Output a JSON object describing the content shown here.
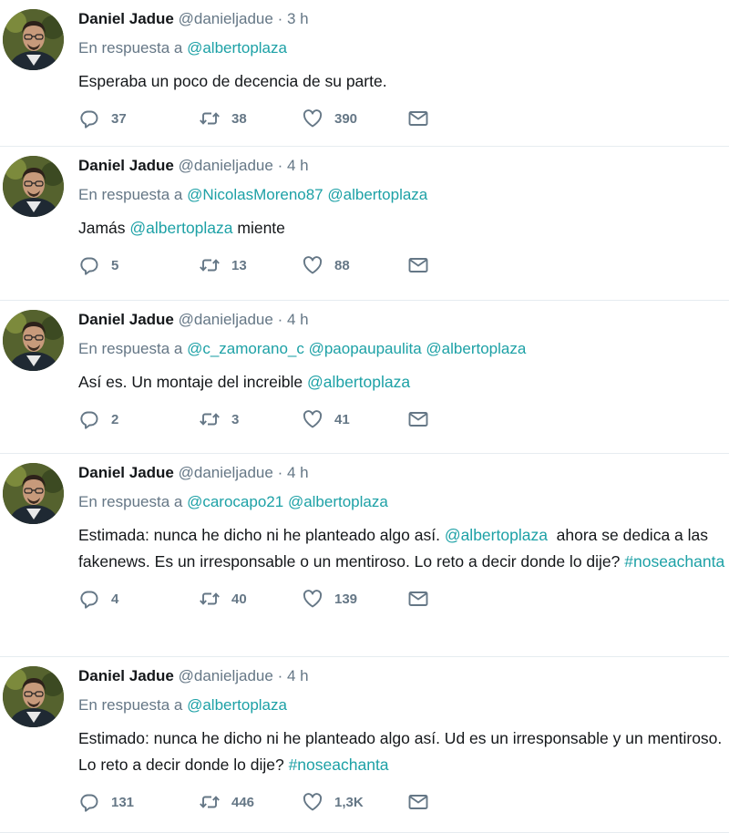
{
  "tweets": [
    {
      "name": "Daniel Jadue",
      "handle": "@danieljadue",
      "separator": "·",
      "time": "3 h",
      "reply_prefix": "En respuesta a",
      "reply_to": [
        "@albertoplaza"
      ],
      "text": [
        {
          "t": "Esperaba un poco de decencia de su parte.",
          "k": "plain"
        }
      ],
      "replies": "37",
      "retweets": "38",
      "likes": "390"
    },
    {
      "name": "Daniel Jadue",
      "handle": "@danieljadue",
      "separator": "·",
      "time": "4 h",
      "reply_prefix": "En respuesta a",
      "reply_to": [
        "@NicolasMoreno87",
        "@albertoplaza"
      ],
      "text": [
        {
          "t": "Jamás ",
          "k": "plain"
        },
        {
          "t": "@albertoplaza",
          "k": "mention"
        },
        {
          "t": " miente",
          "k": "plain"
        }
      ],
      "replies": "5",
      "retweets": "13",
      "likes": "88"
    },
    {
      "name": "Daniel Jadue",
      "handle": "@danieljadue",
      "separator": "·",
      "time": "4 h",
      "reply_prefix": "En respuesta a",
      "reply_to": [
        "@c_zamorano_c",
        "@paopaupaulita",
        "@albertoplaza"
      ],
      "text": [
        {
          "t": "Así es. Un montaje del increible ",
          "k": "plain"
        },
        {
          "t": "@albertoplaza",
          "k": "mention"
        }
      ],
      "replies": "2",
      "retweets": "3",
      "likes": "41"
    },
    {
      "name": "Daniel Jadue",
      "handle": "@danieljadue",
      "separator": "·",
      "time": "4 h",
      "reply_prefix": "En respuesta a",
      "reply_to": [
        "@carocapo21",
        "@albertoplaza"
      ],
      "text": [
        {
          "t": "Estimada: nunca he dicho ni he planteado algo así. ",
          "k": "plain"
        },
        {
          "t": "@albertoplaza",
          "k": "mention"
        },
        {
          "t": "  ahora se dedica a las fakenews. Es un irresponsable o un mentiroso. Lo reto a decir donde lo dije? ",
          "k": "plain"
        },
        {
          "t": "#noseachanta",
          "k": "hashtag"
        }
      ],
      "replies": "4",
      "retweets": "40",
      "likes": "139"
    },
    {
      "name": "Daniel Jadue",
      "handle": "@danieljadue",
      "separator": "·",
      "time": "4 h",
      "reply_prefix": "En respuesta a",
      "reply_to": [
        "@albertoplaza"
      ],
      "text": [
        {
          "t": "Estimado: nunca he dicho ni he planteado algo así. Ud es un irresponsable y un mentiroso. Lo reto a decir donde lo dije? ",
          "k": "plain"
        },
        {
          "t": "#noseachanta",
          "k": "hashtag"
        }
      ],
      "replies": "131",
      "retweets": "446",
      "likes": "1,3K"
    }
  ],
  "icons": {
    "reply": "reply-icon",
    "retweet": "retweet-icon",
    "like": "heart-icon",
    "dm": "envelope-icon"
  },
  "colors": {
    "link": "#1da1a6",
    "muted": "#657786",
    "text": "#14171a",
    "divider": "#e6ecf0"
  }
}
